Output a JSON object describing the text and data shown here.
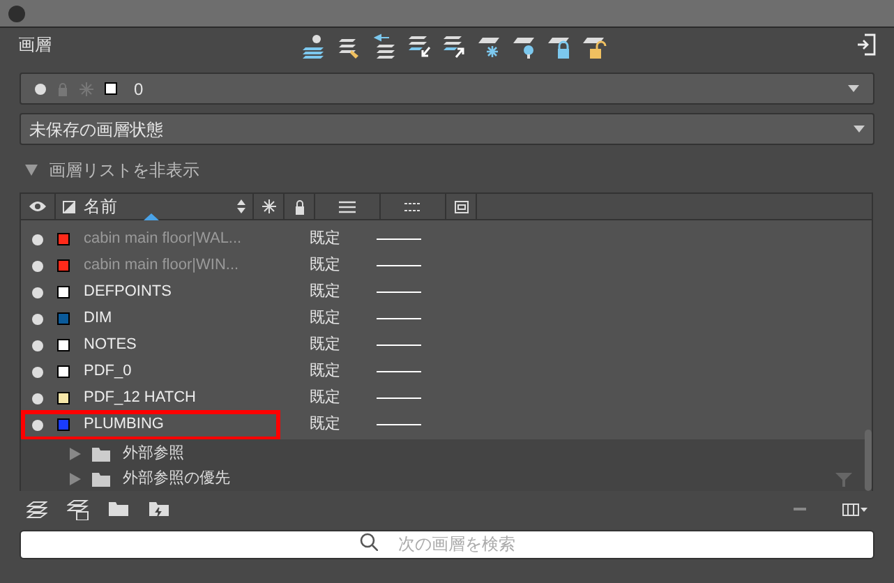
{
  "panel": {
    "title": "画層"
  },
  "current_layer": {
    "name": "0",
    "color": "#ffffff"
  },
  "layer_state": {
    "value": "未保存の画層状態"
  },
  "list_toggle": {
    "label": "画層リストを非表示",
    "expanded": true
  },
  "table": {
    "columns": [
      {
        "kind": "eye"
      },
      {
        "kind": "name",
        "label": "名前"
      },
      {
        "kind": "freeze"
      },
      {
        "kind": "lock"
      },
      {
        "kind": "linetype"
      },
      {
        "kind": "lineweight"
      },
      {
        "kind": "plot"
      }
    ],
    "rows": [
      {
        "name": "cabin main floor|WAL...",
        "color": "#ff2a1a",
        "dimmed": true,
        "linetype": "既定",
        "highlighted": false
      },
      {
        "name": "cabin main floor|WIN...",
        "color": "#ff2a1a",
        "dimmed": true,
        "linetype": "既定",
        "highlighted": false
      },
      {
        "name": "DEFPOINTS",
        "color": "#ffffff",
        "dimmed": false,
        "linetype": "既定",
        "highlighted": false
      },
      {
        "name": "DIM",
        "color": "#0a5a9a",
        "dimmed": false,
        "linetype": "既定",
        "highlighted": false
      },
      {
        "name": "NOTES",
        "color": "#ffffff",
        "dimmed": false,
        "linetype": "既定",
        "highlighted": false
      },
      {
        "name": "PDF_0",
        "color": "#ffffff",
        "dimmed": false,
        "linetype": "既定",
        "highlighted": false
      },
      {
        "name": "PDF_12 HATCH",
        "color": "#f5e6a8",
        "dimmed": false,
        "linetype": "既定",
        "highlighted": false
      },
      {
        "name": "PLUMBING",
        "color": "#1a3cff",
        "dimmed": false,
        "linetype": "既定",
        "highlighted": true
      }
    ]
  },
  "groups": [
    {
      "label": "外部参照",
      "expanded": false
    },
    {
      "label": "外部参照の優先",
      "expanded": false
    }
  ],
  "search": {
    "placeholder": "次の画層を検索"
  }
}
